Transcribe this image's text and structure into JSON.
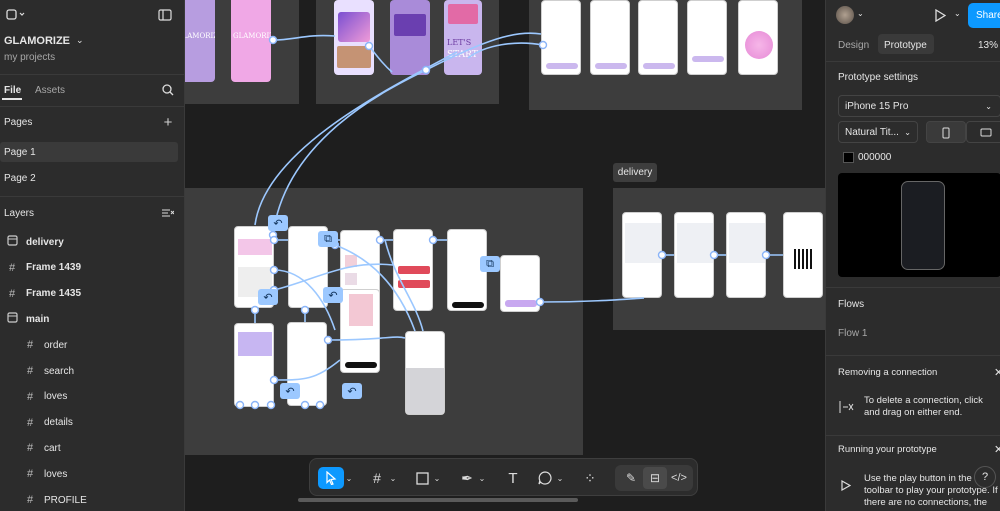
{
  "file": {
    "title": "GLAMORIZE",
    "project": "my projects"
  },
  "left_tabs": {
    "file": "File",
    "assets": "Assets"
  },
  "pages": {
    "heading": "Pages",
    "items": [
      "Page 1",
      "Page 2"
    ]
  },
  "layers": {
    "heading": "Layers",
    "items": [
      {
        "name": "delivery",
        "icon": "frame-icon"
      },
      {
        "name": "Frame 1439",
        "icon": "hash-icon"
      },
      {
        "name": "Frame 1435",
        "icon": "hash-icon"
      },
      {
        "name": "main",
        "icon": "frame-icon"
      },
      {
        "name": "order",
        "icon": "hash-icon"
      },
      {
        "name": "search",
        "icon": "hash-icon"
      },
      {
        "name": "loves",
        "icon": "hash-icon"
      },
      {
        "name": "details",
        "icon": "hash-icon"
      },
      {
        "name": "cart",
        "icon": "hash-icon"
      },
      {
        "name": "loves",
        "icon": "hash-icon"
      },
      {
        "name": "PROFILE",
        "icon": "hash-icon"
      }
    ]
  },
  "canvas": {
    "delivery_label": "delivery",
    "top_phone_texts": [
      "GLAMORIZE",
      "GLAMORIZE",
      "LET'S",
      "START"
    ]
  },
  "right_panel": {
    "tabs": {
      "design": "Design",
      "prototype": "Prototype"
    },
    "zoom": "13%",
    "share": "Share",
    "proto_settings": "Prototype settings",
    "device": "iPhone 15 Pro",
    "model": "Natural Tit...",
    "bg_color": "000000",
    "flows_heading": "Flows",
    "flow_item": "Flow 1",
    "removing_heading": "Removing a connection",
    "removing_text": "To delete a connection, click and drag on either end.",
    "running_heading": "Running your prototype",
    "running_text": "Use the play button in the toolbar to play your prototype. If there are no connections, the"
  },
  "colors": {
    "accent": "#0d99ff",
    "connector": "#9cc8ff",
    "pink": "#e7a7e0",
    "purple": "#b98ad9"
  }
}
